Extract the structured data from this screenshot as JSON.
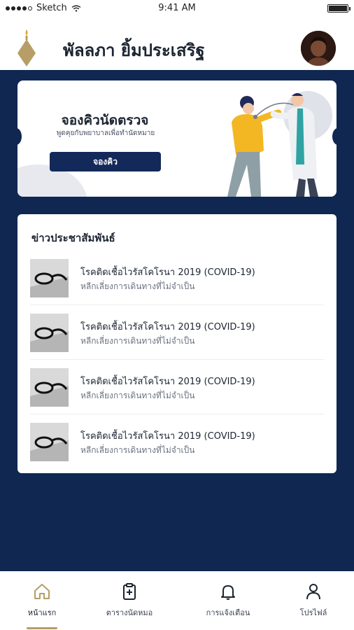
{
  "status_bar": {
    "carrier": "Sketch",
    "time": "9:41 AM"
  },
  "header": {
    "user_name": "พัลลภา ยิ้มประเสริฐ",
    "accent": "#b79d66",
    "logo_icon": "gold-diamond-flame-logo",
    "avatar_icon": "user-avatar-photo"
  },
  "booking": {
    "title": "จองคิวนัดตรวจ",
    "subtitle": "พูดคุยกับพยาบาลเพื่อทำนัดหมาย",
    "button_label": "จองคิว",
    "illustration": "doctor-stethoscope-patient-illustration"
  },
  "news": {
    "title": "ข่าวประชาสัมพันธ์",
    "items": [
      {
        "title": "โรคติดเชื้อไวรัสโคโรนา 2019 (COVID-19)",
        "subtitle": "หลีกเลี่ยงการเดินทางที่ไม่จำเป็น",
        "thumb_icon": "stethoscope-photo"
      },
      {
        "title": "โรคติดเชื้อไวรัสโคโรนา 2019 (COVID-19)",
        "subtitle": "หลีกเลี่ยงการเดินทางที่ไม่จำเป็น",
        "thumb_icon": "stethoscope-photo"
      },
      {
        "title": "โรคติดเชื้อไวรัสโคโรนา 2019 (COVID-19)",
        "subtitle": "หลีกเลี่ยงการเดินทางที่ไม่จำเป็น",
        "thumb_icon": "stethoscope-photo"
      },
      {
        "title": "โรคติดเชื้อไวรัสโคโรนา 2019 (COVID-19)",
        "subtitle": "หลีกเลี่ยงการเดินทางที่ไม่จำเป็น",
        "thumb_icon": "stethoscope-photo"
      }
    ]
  },
  "nav": {
    "items": [
      {
        "label": "หน้าแรก",
        "icon": "home-icon",
        "active": true
      },
      {
        "label": "ตารางนัดหมอ",
        "icon": "clipboard-plus-icon",
        "active": false
      },
      {
        "label": "การแจ้งเตือน",
        "icon": "bell-icon",
        "active": false
      },
      {
        "label": "โปรไฟล์",
        "icon": "user-icon",
        "active": false
      }
    ]
  },
  "colors": {
    "navy": "#0f2751",
    "button": "#13295a",
    "gold": "#b79d66"
  }
}
